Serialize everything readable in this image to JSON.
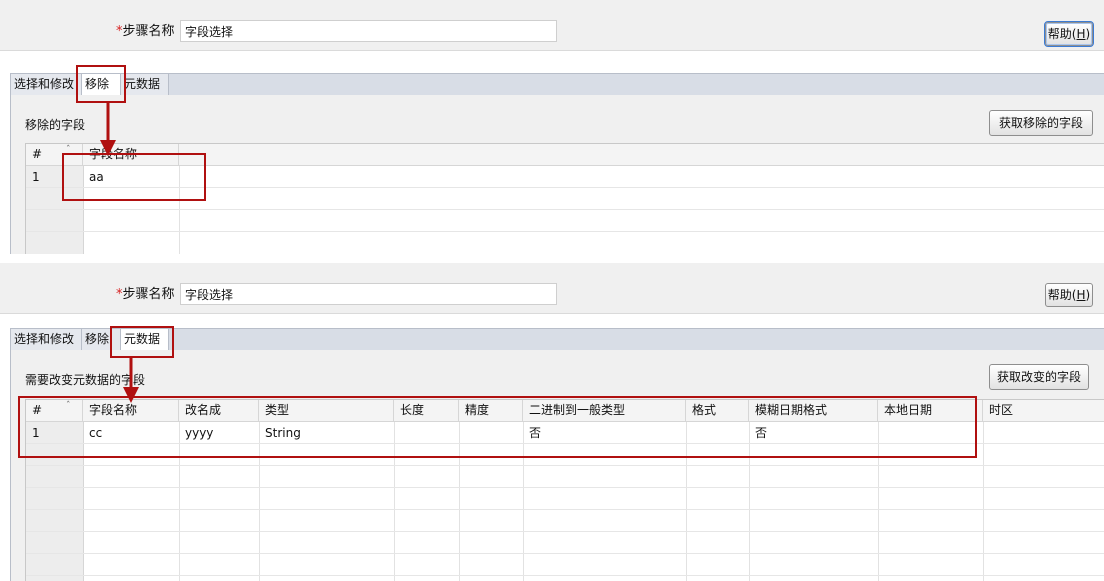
{
  "panel_top": {
    "step_label": "步骤名称",
    "required_marker": "*",
    "step_value": "字段选择",
    "help_button": "帮助(",
    "help_mnemonic": "H",
    "help_close": ")",
    "tabs": [
      "选择和修改",
      "移除",
      "元数据"
    ],
    "section_label": "移除的字段",
    "get_button": "获取移除的字段",
    "columns": [
      "#",
      "字段名称"
    ],
    "rows": [
      [
        "1",
        "aa"
      ]
    ]
  },
  "panel_bottom": {
    "step_label": "步骤名称",
    "required_marker": "*",
    "step_value": "字段选择",
    "help_button": "帮助(",
    "help_mnemonic": "H",
    "help_close": ")",
    "tabs": [
      "选择和修改",
      "移除",
      "元数据"
    ],
    "section_label": "需要改变元数据的字段",
    "get_button": "获取改变的字段",
    "columns": [
      "#",
      "字段名称",
      "改名成",
      "类型",
      "长度",
      "精度",
      "二进制到一般类型",
      "格式",
      "模糊日期格式",
      "本地日期",
      "时区"
    ],
    "rows": [
      [
        "1",
        "cc",
        "yyyy",
        "String",
        "",
        "",
        "否",
        "",
        "否",
        "",
        ""
      ]
    ]
  },
  "colors": {
    "highlight": "#b01010",
    "tab_bg": "#d8dde6",
    "panel_bg": "#f0f0f0"
  }
}
